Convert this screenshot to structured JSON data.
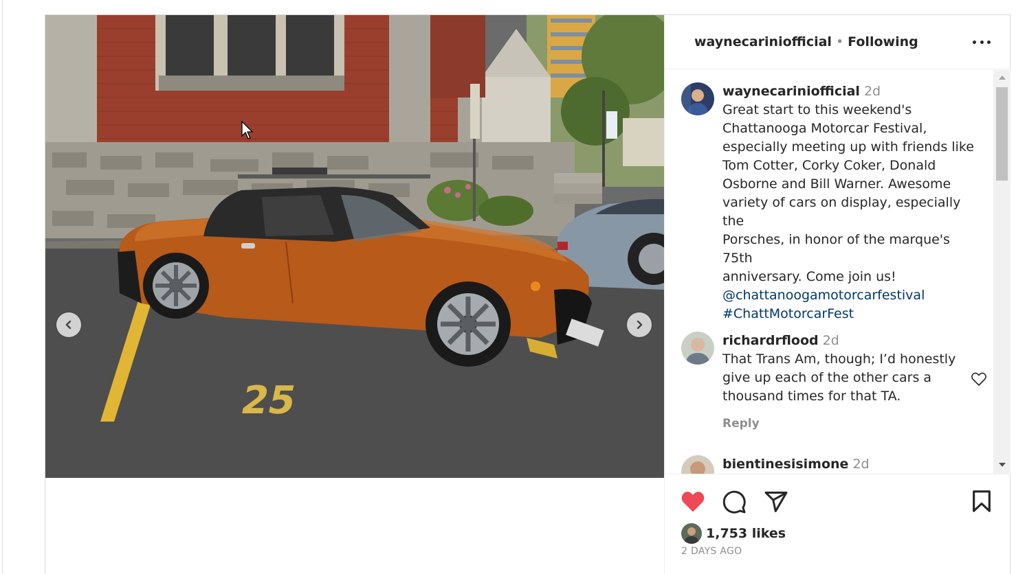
{
  "post": {
    "author": "waynecariniofficial",
    "follow_status": "Following",
    "separator": "•"
  },
  "media": {
    "description_icon": "photo",
    "parking_number": "25"
  },
  "caption": {
    "username": "waynecariniofficial",
    "time": "2d",
    "lines": [
      "Great start to this weekend's",
      "Chattanooga Motorcar Festival,",
      "especially meeting up with friends like",
      "Tom Cotter, Corky Coker, Donald",
      "Osborne and Bill Warner. Awesome",
      "variety of cars on display, especially the",
      "Porsches, in honor of the marque's 75th",
      "anniversary. Come join us!"
    ],
    "mention": "@chattanoogamotorcarfestival",
    "hashtag": "#ChattMotorcarFest"
  },
  "comments": [
    {
      "username": "richardrflood",
      "time": "2d",
      "lines": [
        "That Trans Am, though; I’d honestly",
        "give up each of the other cars a",
        "thousand times for that TA."
      ],
      "reply_label": "Reply"
    },
    {
      "username": "bientinesisimone",
      "time": "2d"
    }
  ],
  "actions": {
    "likes": "1,753 likes",
    "posted_ago": "2 DAYS AGO",
    "liked_color": "#ed4956"
  }
}
